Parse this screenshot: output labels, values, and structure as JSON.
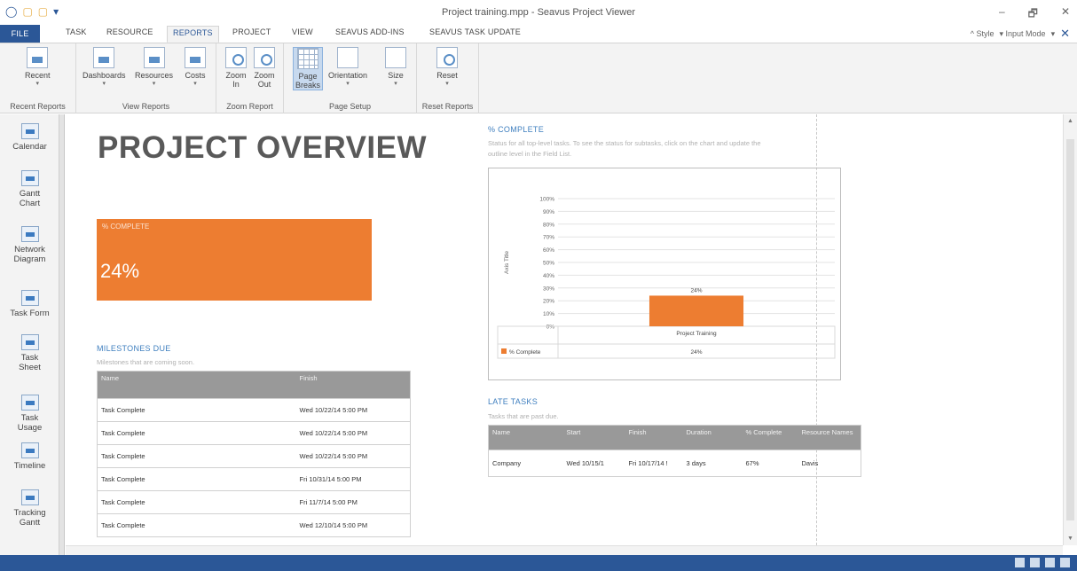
{
  "window": {
    "title": "Project training.mpp - Seavus Project Viewer",
    "min": "–",
    "restore": "🗗",
    "close": "✕"
  },
  "qat": [
    "◯",
    "▢",
    "▢",
    "▾"
  ],
  "tabs": {
    "file": "FILE",
    "task": "TASK",
    "resource": "RESOURCE",
    "reports": "REPORTS",
    "project": "PROJECT",
    "view": "VIEW",
    "addins": "SEAVUS ADD-INS",
    "taskupdate": "SEAVUS TASK UPDATE"
  },
  "ribbon_right": {
    "style": "^ Style",
    "input_mode": "▾ Input Mode",
    "pin": "▾",
    "close": "✕"
  },
  "ribbon": {
    "recent": {
      "label": "Recent",
      "group": "Recent Reports"
    },
    "view_reports": {
      "dashboards": "Dashboards",
      "resources": "Resources",
      "costs": "Costs",
      "group": "View Reports"
    },
    "zoom": {
      "zoom_in_1": "Zoom",
      "zoom_in_2": "In",
      "zoom_out_1": "Zoom",
      "zoom_out_2": "Out",
      "group": "Zoom Report"
    },
    "page_setup": {
      "breaks_1": "Page",
      "breaks_2": "Breaks",
      "orientation": "Orientation",
      "size": "Size",
      "group": "Page Setup"
    },
    "reset": {
      "label": "Reset",
      "group": "Reset Reports"
    }
  },
  "views": [
    {
      "l1": "Calendar",
      "l2": ""
    },
    {
      "l1": "Gantt",
      "l2": "Chart"
    },
    {
      "l1": "Network",
      "l2": "Diagram"
    },
    {
      "l1": "Task Form",
      "l2": ""
    },
    {
      "l1": "Task",
      "l2": "Sheet"
    },
    {
      "l1": "Task",
      "l2": "Usage"
    },
    {
      "l1": "Timeline",
      "l2": ""
    },
    {
      "l1": "Tracking",
      "l2": "Gantt"
    }
  ],
  "report": {
    "title": "PROJECT OVERVIEW",
    "kpi": {
      "label": "% COMPLETE",
      "value": "24%"
    },
    "milestones": {
      "title": "MILESTONES DUE",
      "subtitle": "Milestones that are coming soon.",
      "headers": [
        "Name",
        "Finish"
      ],
      "rows": [
        [
          "Task Complete",
          "Wed 10/22/14 5:00 PM"
        ],
        [
          "Task Complete",
          "Wed 10/22/14 5:00 PM"
        ],
        [
          "Task Complete",
          "Wed 10/22/14 5:00 PM"
        ],
        [
          "Task Complete",
          "Fri 10/31/14 5:00 PM"
        ],
        [
          "Task Complete",
          "Fri 11/7/14 5:00 PM"
        ],
        [
          "Task Complete",
          "Wed 12/10/14 5:00 PM"
        ]
      ]
    },
    "pct_complete": {
      "title": "% COMPLETE",
      "subtitle_1": "Status for all top-level tasks. To see the status for subtasks, click on the chart and update the",
      "subtitle_2": "outline level in the Field List."
    },
    "late_tasks": {
      "title": "LATE TASKS",
      "subtitle": "Tasks that are past due.",
      "headers": [
        "Name",
        "Start",
        "Finish",
        "Duration",
        "% Complete",
        "Resource Names"
      ],
      "rows": [
        [
          "Company",
          "Wed 10/15/1",
          "Fri 10/17/14 !",
          "3 days",
          "67%",
          "Davis"
        ]
      ]
    }
  },
  "chart_data": {
    "type": "bar",
    "categories": [
      "Project Training"
    ],
    "series": [
      {
        "name": "% Complete",
        "values": [
          24
        ]
      }
    ],
    "data_labels": [
      "24%"
    ],
    "ylabel": "Axis Title",
    "ylim": [
      0,
      100
    ],
    "yticks": [
      "0%",
      "10%",
      "20%",
      "30%",
      "40%",
      "50%",
      "60%",
      "70%",
      "80%",
      "90%",
      "100%"
    ],
    "grid": true,
    "legend": "bottom",
    "data_table": {
      "legend_label": "% Complete",
      "value": "24%"
    },
    "color": "#ed7d31"
  }
}
